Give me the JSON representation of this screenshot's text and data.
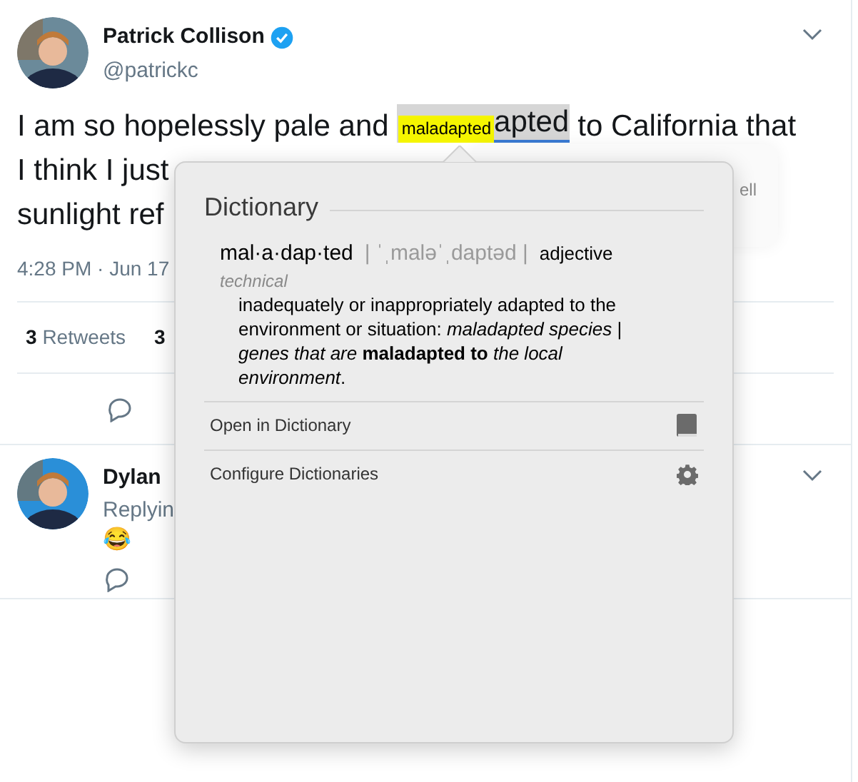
{
  "tweet": {
    "name": "Patrick Collison",
    "verified": true,
    "handle": "@patrickc",
    "text_lines": [
      {
        "before": "I am so hopelessly pale and",
        "highlight": "apted",
        "after": "to California that"
      },
      {
        "before": "I think I just"
      },
      {
        "before": "sunlight ref"
      }
    ],
    "timestamp": "4:28 PM · Jun 17",
    "stats": [
      {
        "count": "3",
        "label": "Retweets"
      },
      {
        "count": "3"
      }
    ],
    "card_fragment": "ell"
  },
  "lookup_label": "maladapted",
  "dictionary": {
    "title": "Dictionary",
    "headword": "mal·a·dap·ted",
    "pronunciation": "| ˈˌmaləˈˌdaptəd |",
    "part_of_speech": "adjective",
    "register": "technical",
    "definition": "inadequately or inappropriately adapted to the environment or situation: *maladapted species* | *genes that are* **maladapted to** *the local environment*.",
    "actions": [
      {
        "label": "Open in Dictionary",
        "kind": "book"
      },
      {
        "label": "Configure Dictionaries",
        "kind": "gear"
      }
    ]
  },
  "reply": {
    "name": "Dylan",
    "replying": "Replyin",
    "emoji": "😂"
  }
}
